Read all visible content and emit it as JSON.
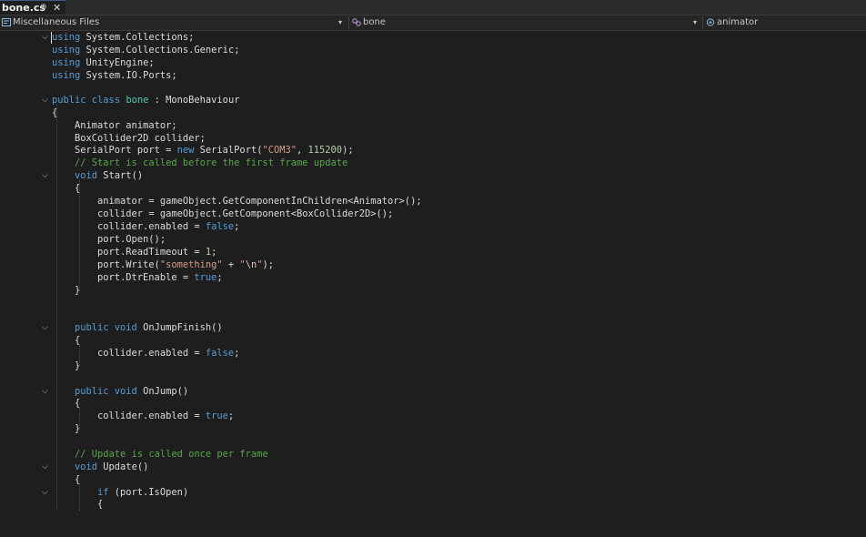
{
  "tab": {
    "label": "bone.cs",
    "pin": "⊕",
    "close": "✕"
  },
  "navbar": {
    "project": "Miscellaneous Files",
    "class": "bone",
    "member": "animator"
  },
  "colors": {
    "keyword": "#569cd6",
    "type": "#4ec9b0",
    "string": "#d69d85",
    "comment": "#57a64a",
    "number": "#b5cea8",
    "text": "#dcdcdc",
    "background": "#1e1e1e"
  },
  "code": {
    "l1": [
      [
        "kw",
        "using"
      ],
      [
        "",
        "System.Collections;"
      ]
    ],
    "l2": [
      [
        "kw",
        "using"
      ],
      [
        "",
        "System.Collections.Generic;"
      ]
    ],
    "l3": [
      [
        "kw",
        "using"
      ],
      [
        "",
        "UnityEngine;"
      ]
    ],
    "l4": [
      [
        "kw",
        "using"
      ],
      [
        "",
        "System.IO.Ports;"
      ]
    ],
    "l5": [
      [
        "kw",
        "public class "
      ],
      [
        "ty",
        "bone"
      ],
      [
        "",
        " : MonoBehaviour"
      ]
    ],
    "l6": [
      [
        "",
        "{"
      ]
    ],
    "l7": [
      [
        "",
        "Animator animator;"
      ]
    ],
    "l8": [
      [
        "",
        "BoxCollider2D collider;"
      ]
    ],
    "l9": [
      [
        "",
        "SerialPort port = "
      ],
      [
        "kw",
        "new"
      ],
      [
        "",
        " SerialPort("
      ],
      [
        "st",
        "\"COM3\""
      ],
      [
        "",
        ", "
      ],
      [
        "nm",
        "115200"
      ],
      [
        "",
        ");"
      ]
    ],
    "l10": [
      [
        "cm",
        "// Start is called before the first frame update"
      ]
    ],
    "l11": [
      [
        "kw",
        "void"
      ],
      [
        "",
        " Start()"
      ]
    ],
    "l12": [
      [
        "",
        "{"
      ]
    ],
    "l13": [
      [
        "",
        "animator = gameObject.GetComponentInChildren<Animator>();"
      ]
    ],
    "l14": [
      [
        "",
        "collider = gameObject.GetComponent<BoxCollider2D>();"
      ]
    ],
    "l15": [
      [
        "",
        "collider.enabled = "
      ],
      [
        "kw",
        "false"
      ],
      [
        "",
        ";"
      ]
    ],
    "l16": [
      [
        "",
        "port.Open();"
      ]
    ],
    "l17": [
      [
        "",
        "port.ReadTimeout = "
      ],
      [
        "nm",
        "1"
      ],
      [
        "",
        ";"
      ]
    ],
    "l18": [
      [
        "",
        "port.Write("
      ],
      [
        "st",
        "\"something\""
      ],
      [
        "",
        " + "
      ],
      [
        "st",
        "\""
      ],
      [
        "es",
        "\\n"
      ],
      [
        "st",
        "\""
      ],
      [
        "",
        ");"
      ]
    ],
    "l19": [
      [
        "",
        "port.DtrEnable = "
      ],
      [
        "kw",
        "true"
      ],
      [
        "",
        ";"
      ]
    ],
    "l20": [
      [
        "",
        "}"
      ]
    ],
    "l21": [
      [
        "kw",
        "public void"
      ],
      [
        "",
        " OnJumpFinish()"
      ]
    ],
    "l22": [
      [
        "",
        "{"
      ]
    ],
    "l23": [
      [
        "",
        "collider.enabled = "
      ],
      [
        "kw",
        "false"
      ],
      [
        "",
        ";"
      ]
    ],
    "l24": [
      [
        "",
        "}"
      ]
    ],
    "l25": [
      [
        "kw",
        "public void"
      ],
      [
        "",
        " OnJump()"
      ]
    ],
    "l26": [
      [
        "",
        "{"
      ]
    ],
    "l27": [
      [
        "",
        "collider.enabled = "
      ],
      [
        "kw",
        "true"
      ],
      [
        "",
        ";"
      ]
    ],
    "l28": [
      [
        "",
        "}"
      ]
    ],
    "l29": [
      [
        "cm",
        "// Update is called once per frame"
      ]
    ],
    "l30": [
      [
        "kw",
        "void"
      ],
      [
        "",
        " Update()"
      ]
    ],
    "l31": [
      [
        "",
        "{"
      ]
    ],
    "l32": [
      [
        "kw",
        "if"
      ],
      [
        "",
        " (port.IsOpen)"
      ]
    ],
    "l33": [
      [
        "",
        "{"
      ]
    ]
  }
}
